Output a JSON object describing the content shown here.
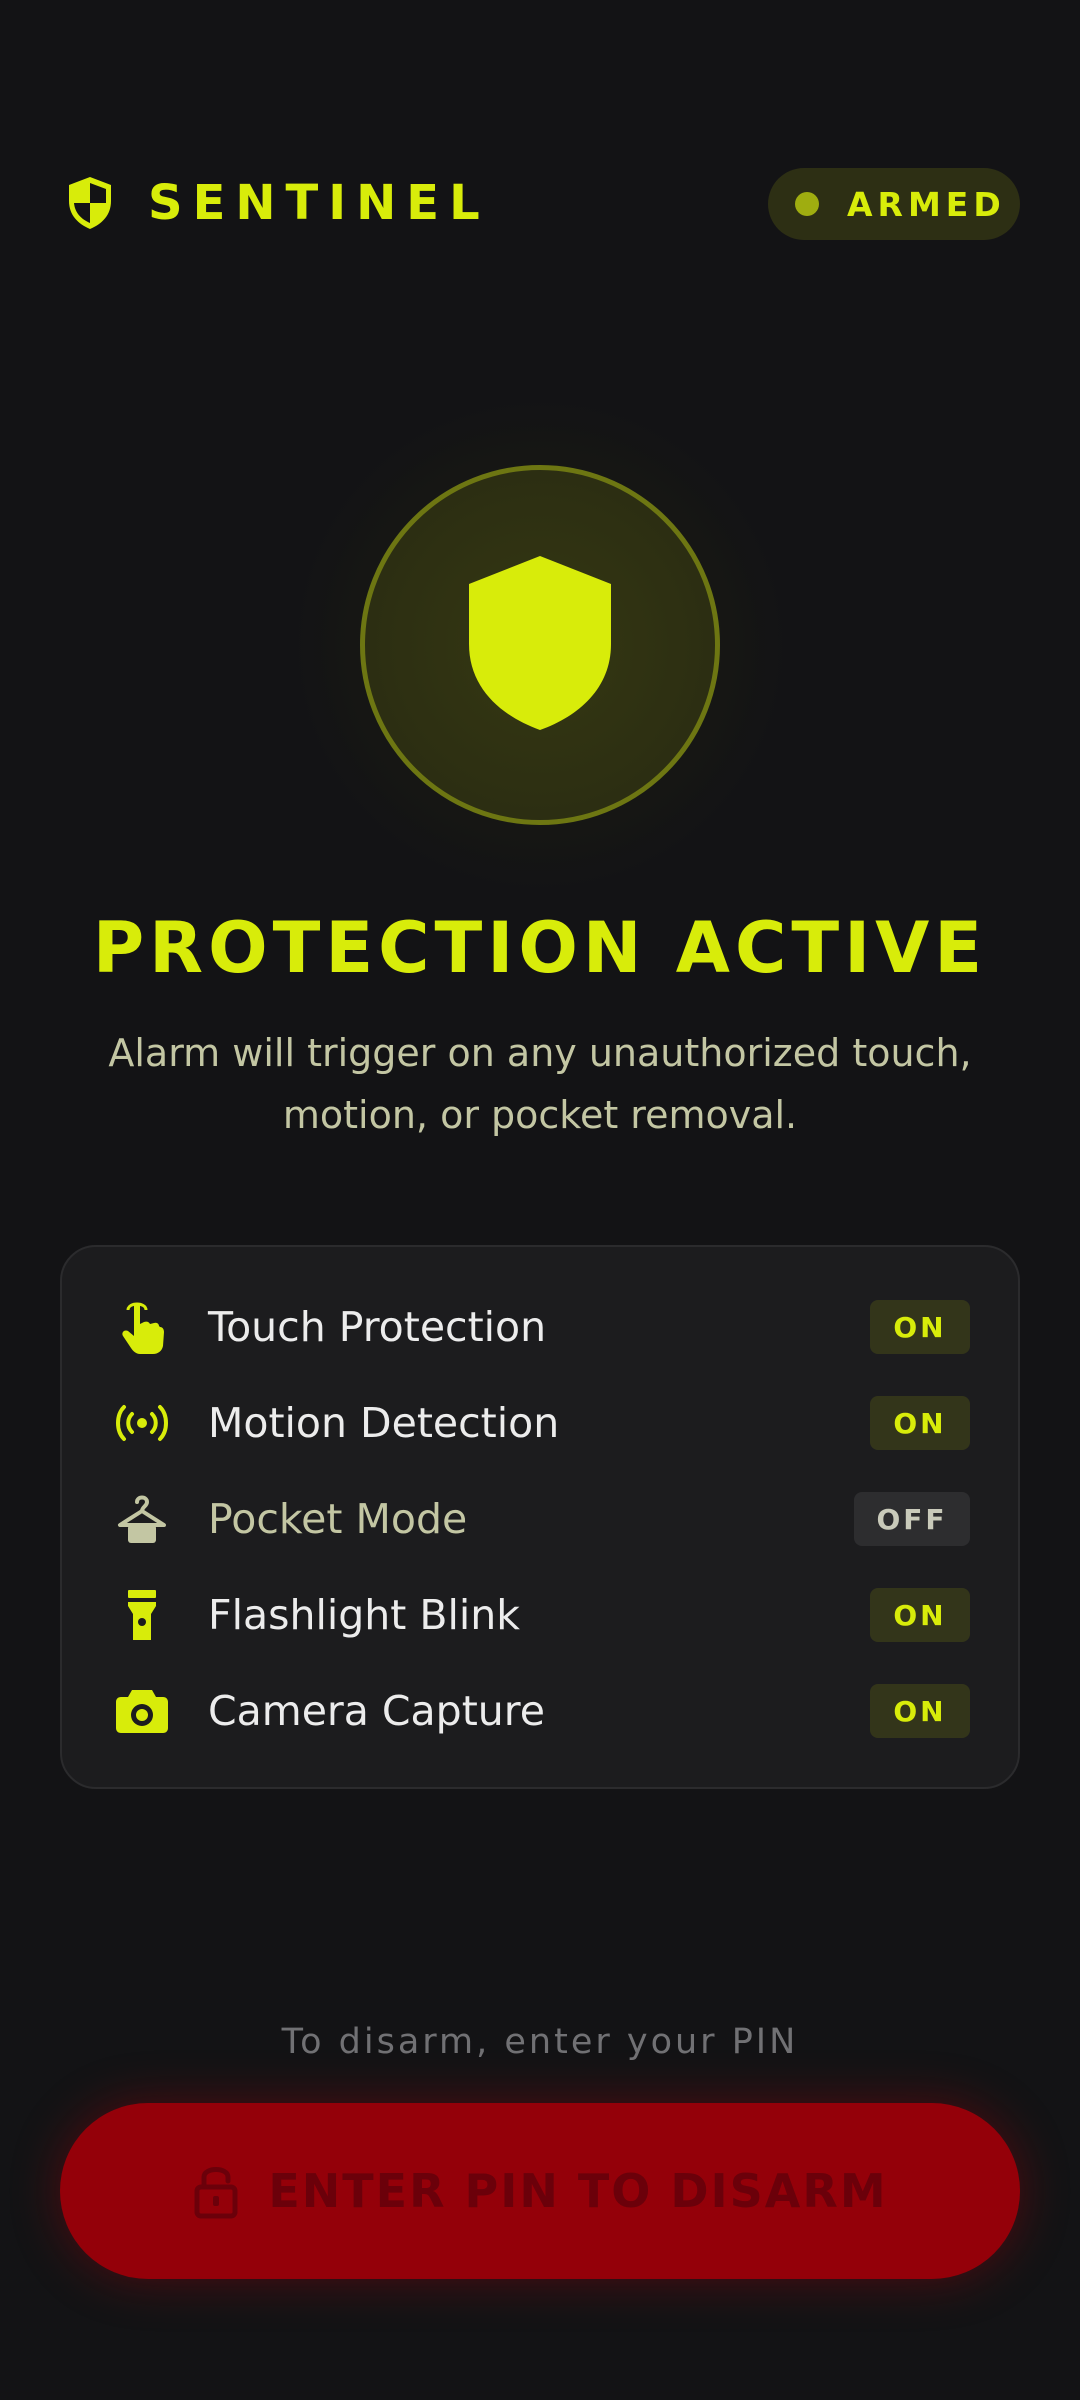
{
  "app": {
    "name": "SENTINEL",
    "logo_icon": "shield-half-icon",
    "accent_color": "#d8ec0a",
    "background_color": "#131315"
  },
  "status": {
    "label": "ARMED",
    "indicator_color": "#9fad10"
  },
  "hero": {
    "icon": "shield-icon",
    "title": "PROTECTION ACTIVE",
    "subtitle": "Alarm will trigger on any unauthorized touch, motion, or pocket removal."
  },
  "features": [
    {
      "label": "Touch Protection",
      "icon": "touch-hand-icon",
      "state": "ON"
    },
    {
      "label": "Motion Detection",
      "icon": "motion-waves-icon",
      "state": "ON"
    },
    {
      "label": "Pocket Mode",
      "icon": "hanger-icon",
      "state": "OFF"
    },
    {
      "label": "Flashlight Blink",
      "icon": "flashlight-icon",
      "state": "ON"
    },
    {
      "label": "Camera Capture",
      "icon": "camera-icon",
      "state": "ON"
    }
  ],
  "footer": {
    "hint": "To disarm, enter your PIN",
    "button_label": "ENTER PIN TO DISARM",
    "button_icon": "lock-icon",
    "button_color": "#940009"
  }
}
